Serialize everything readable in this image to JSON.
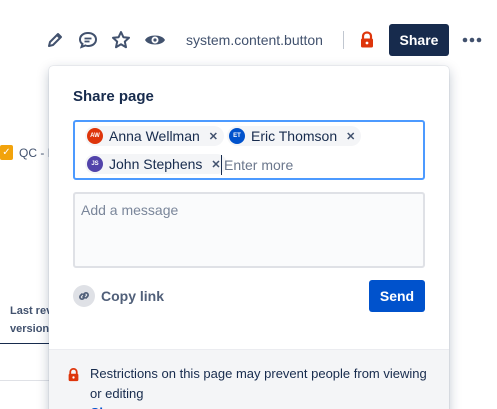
{
  "toolbar": {
    "system_label": "system.content.button",
    "share_label": "Share",
    "icons": [
      "edit-icon",
      "comment-icon",
      "star-icon",
      "watch-icon",
      "lock-icon",
      "more-icon"
    ],
    "lock_color": "#de350b"
  },
  "background": {
    "qc_label": "QC - I",
    "last_rev_line1": "Last rev",
    "last_rev_line2": "version"
  },
  "dialog": {
    "title": "Share page",
    "recipients": [
      {
        "initials": "AW",
        "name": "Anna Wellman",
        "color": "#de350b"
      },
      {
        "initials": "ET",
        "name": "Eric Thomson",
        "color": "#0052cc"
      },
      {
        "initials": "JS",
        "name": "John Stephens",
        "color": "#5243aa"
      }
    ],
    "enter_more_placeholder": "Enter more",
    "message_placeholder": "Add a message",
    "copy_link_label": "Copy link",
    "send_label": "Send",
    "restriction_text": "Restrictions on this page may prevent people from viewing or editing",
    "change_link_label": "Ch",
    "accent_color": "#0052cc"
  }
}
